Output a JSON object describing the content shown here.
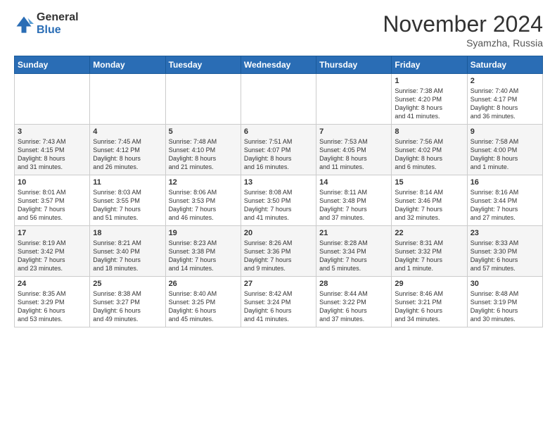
{
  "logo": {
    "general": "General",
    "blue": "Blue"
  },
  "title": "November 2024",
  "location": "Syamzha, Russia",
  "days_header": [
    "Sunday",
    "Monday",
    "Tuesday",
    "Wednesday",
    "Thursday",
    "Friday",
    "Saturday"
  ],
  "weeks": [
    [
      {
        "day": "",
        "info": ""
      },
      {
        "day": "",
        "info": ""
      },
      {
        "day": "",
        "info": ""
      },
      {
        "day": "",
        "info": ""
      },
      {
        "day": "",
        "info": ""
      },
      {
        "day": "1",
        "info": "Sunrise: 7:38 AM\nSunset: 4:20 PM\nDaylight: 8 hours\nand 41 minutes."
      },
      {
        "day": "2",
        "info": "Sunrise: 7:40 AM\nSunset: 4:17 PM\nDaylight: 8 hours\nand 36 minutes."
      }
    ],
    [
      {
        "day": "3",
        "info": "Sunrise: 7:43 AM\nSunset: 4:15 PM\nDaylight: 8 hours\nand 31 minutes."
      },
      {
        "day": "4",
        "info": "Sunrise: 7:45 AM\nSunset: 4:12 PM\nDaylight: 8 hours\nand 26 minutes."
      },
      {
        "day": "5",
        "info": "Sunrise: 7:48 AM\nSunset: 4:10 PM\nDaylight: 8 hours\nand 21 minutes."
      },
      {
        "day": "6",
        "info": "Sunrise: 7:51 AM\nSunset: 4:07 PM\nDaylight: 8 hours\nand 16 minutes."
      },
      {
        "day": "7",
        "info": "Sunrise: 7:53 AM\nSunset: 4:05 PM\nDaylight: 8 hours\nand 11 minutes."
      },
      {
        "day": "8",
        "info": "Sunrise: 7:56 AM\nSunset: 4:02 PM\nDaylight: 8 hours\nand 6 minutes."
      },
      {
        "day": "9",
        "info": "Sunrise: 7:58 AM\nSunset: 4:00 PM\nDaylight: 8 hours\nand 1 minute."
      }
    ],
    [
      {
        "day": "10",
        "info": "Sunrise: 8:01 AM\nSunset: 3:57 PM\nDaylight: 7 hours\nand 56 minutes."
      },
      {
        "day": "11",
        "info": "Sunrise: 8:03 AM\nSunset: 3:55 PM\nDaylight: 7 hours\nand 51 minutes."
      },
      {
        "day": "12",
        "info": "Sunrise: 8:06 AM\nSunset: 3:53 PM\nDaylight: 7 hours\nand 46 minutes."
      },
      {
        "day": "13",
        "info": "Sunrise: 8:08 AM\nSunset: 3:50 PM\nDaylight: 7 hours\nand 41 minutes."
      },
      {
        "day": "14",
        "info": "Sunrise: 8:11 AM\nSunset: 3:48 PM\nDaylight: 7 hours\nand 37 minutes."
      },
      {
        "day": "15",
        "info": "Sunrise: 8:14 AM\nSunset: 3:46 PM\nDaylight: 7 hours\nand 32 minutes."
      },
      {
        "day": "16",
        "info": "Sunrise: 8:16 AM\nSunset: 3:44 PM\nDaylight: 7 hours\nand 27 minutes."
      }
    ],
    [
      {
        "day": "17",
        "info": "Sunrise: 8:19 AM\nSunset: 3:42 PM\nDaylight: 7 hours\nand 23 minutes."
      },
      {
        "day": "18",
        "info": "Sunrise: 8:21 AM\nSunset: 3:40 PM\nDaylight: 7 hours\nand 18 minutes."
      },
      {
        "day": "19",
        "info": "Sunrise: 8:23 AM\nSunset: 3:38 PM\nDaylight: 7 hours\nand 14 minutes."
      },
      {
        "day": "20",
        "info": "Sunrise: 8:26 AM\nSunset: 3:36 PM\nDaylight: 7 hours\nand 9 minutes."
      },
      {
        "day": "21",
        "info": "Sunrise: 8:28 AM\nSunset: 3:34 PM\nDaylight: 7 hours\nand 5 minutes."
      },
      {
        "day": "22",
        "info": "Sunrise: 8:31 AM\nSunset: 3:32 PM\nDaylight: 7 hours\nand 1 minute."
      },
      {
        "day": "23",
        "info": "Sunrise: 8:33 AM\nSunset: 3:30 PM\nDaylight: 6 hours\nand 57 minutes."
      }
    ],
    [
      {
        "day": "24",
        "info": "Sunrise: 8:35 AM\nSunset: 3:29 PM\nDaylight: 6 hours\nand 53 minutes."
      },
      {
        "day": "25",
        "info": "Sunrise: 8:38 AM\nSunset: 3:27 PM\nDaylight: 6 hours\nand 49 minutes."
      },
      {
        "day": "26",
        "info": "Sunrise: 8:40 AM\nSunset: 3:25 PM\nDaylight: 6 hours\nand 45 minutes."
      },
      {
        "day": "27",
        "info": "Sunrise: 8:42 AM\nSunset: 3:24 PM\nDaylight: 6 hours\nand 41 minutes."
      },
      {
        "day": "28",
        "info": "Sunrise: 8:44 AM\nSunset: 3:22 PM\nDaylight: 6 hours\nand 37 minutes."
      },
      {
        "day": "29",
        "info": "Sunrise: 8:46 AM\nSunset: 3:21 PM\nDaylight: 6 hours\nand 34 minutes."
      },
      {
        "day": "30",
        "info": "Sunrise: 8:48 AM\nSunset: 3:19 PM\nDaylight: 6 hours\nand 30 minutes."
      }
    ]
  ]
}
